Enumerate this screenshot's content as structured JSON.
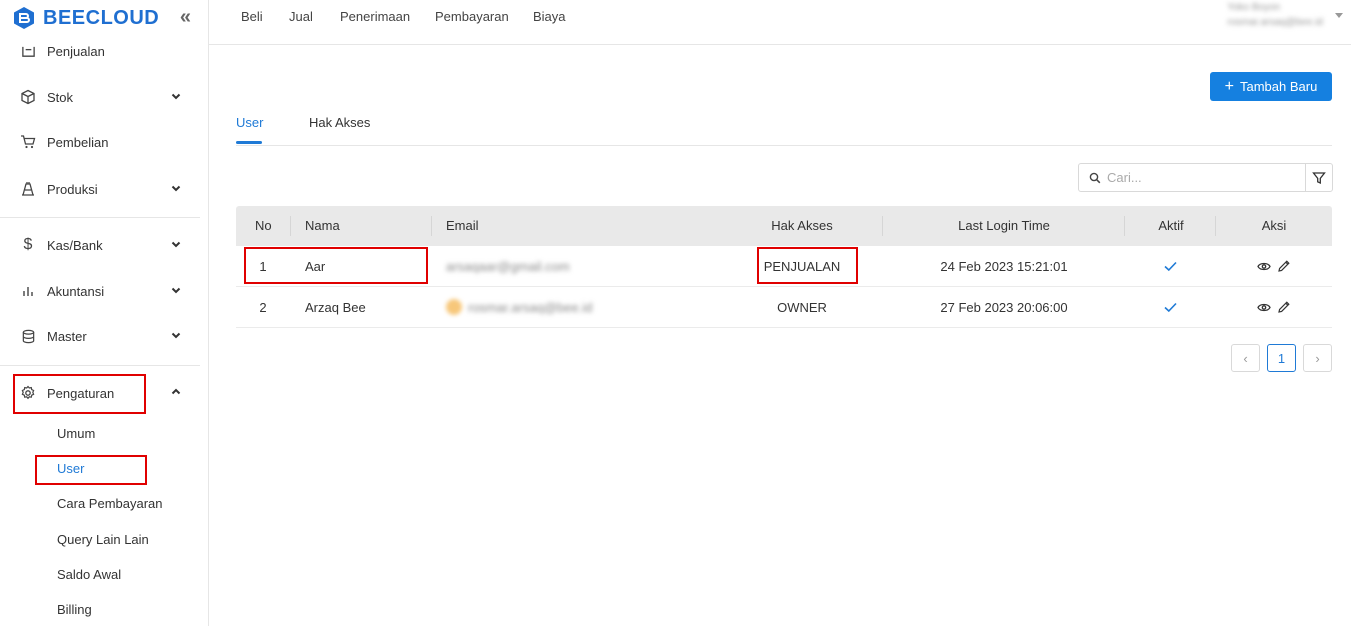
{
  "brand": {
    "name": "BEECLOUD",
    "accent": "#1f6fd1"
  },
  "sidebar": {
    "items": [
      {
        "label": "Penjualan",
        "icon": "receipt-icon"
      },
      {
        "label": "Stok",
        "icon": "box-icon"
      },
      {
        "label": "Pembelian",
        "icon": "cart-icon"
      },
      {
        "label": "Produksi",
        "icon": "factory-icon"
      },
      {
        "label": "Kas/Bank",
        "icon": "dollar-icon"
      },
      {
        "label": "Akuntansi",
        "icon": "bar-chart-icon"
      },
      {
        "label": "Master",
        "icon": "database-icon"
      },
      {
        "label": "Pengaturan",
        "icon": "gear-icon"
      }
    ],
    "subitems": [
      "Umum",
      "User",
      "Cara Pembayaran",
      "Query Lain Lain",
      "Saldo Awal",
      "Billing"
    ]
  },
  "topnav": [
    "Beli",
    "Jual",
    "Penerimaan",
    "Pembayaran",
    "Biaya"
  ],
  "user": {
    "name": "Yoko Boyon",
    "email": "rosmar.arsaq@bee.id"
  },
  "actions": {
    "add_label": "Tambah Baru"
  },
  "tabs": [
    "User",
    "Hak Akses"
  ],
  "search": {
    "placeholder": "Cari..."
  },
  "table": {
    "headers": [
      "No",
      "Nama",
      "Email",
      "Hak Akses",
      "Last Login Time",
      "Aktif",
      "Aksi"
    ],
    "rows": [
      {
        "no": "1",
        "nama": "Aar",
        "email": "arsaqaar@gmail.com",
        "hak_akses": "PENJUALAN",
        "last_login": "24 Feb 2023 15:21:01",
        "aktif": true
      },
      {
        "no": "2",
        "nama": "Arzaq Bee",
        "email": "rosmar.arsaq@bee.id",
        "hak_akses": "OWNER",
        "last_login": "27 Feb 2023 20:06:00",
        "aktif": true
      }
    ]
  },
  "pagination": {
    "current": "1",
    "prev": "‹",
    "next": "›"
  }
}
